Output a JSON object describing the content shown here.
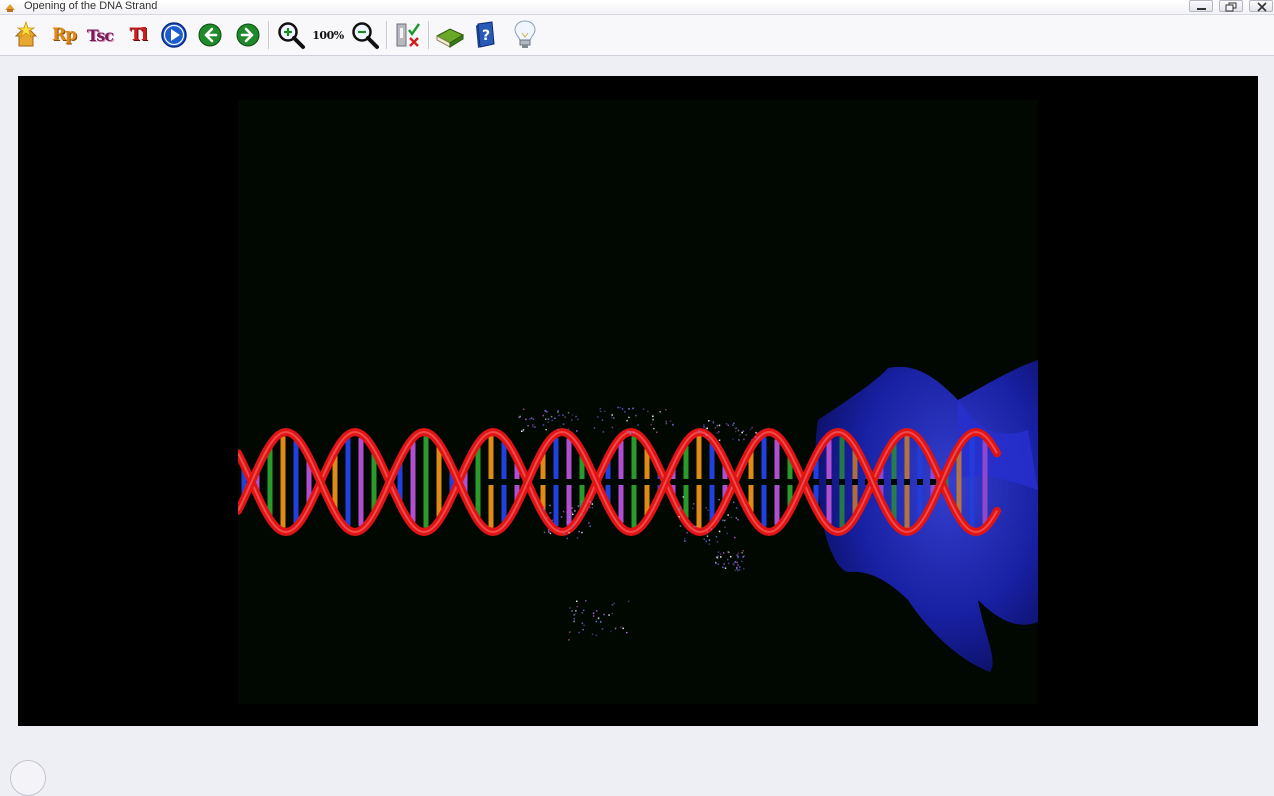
{
  "window": {
    "title": "Opening of the DNA Strand",
    "controls": [
      "minimize",
      "restore",
      "close"
    ]
  },
  "toolbar": {
    "buttons": [
      {
        "name": "home-button",
        "icon": "home-star-icon"
      },
      {
        "name": "rp-button",
        "icon": "rp-letters-icon",
        "label": "Rp",
        "color": "#e08a1a"
      },
      {
        "name": "tsc-button",
        "icon": "tsc-letters-icon",
        "label": "Tsc",
        "color": "#7a1a5a"
      },
      {
        "name": "tl-button",
        "icon": "tl-letters-icon",
        "label": "Tl",
        "color": "#d21c1c"
      },
      {
        "name": "play-button",
        "icon": "play-icon"
      },
      {
        "name": "back-button",
        "icon": "arrow-left-icon"
      },
      {
        "name": "forward-button",
        "icon": "arrow-right-icon"
      },
      {
        "name": "zoom-in-button",
        "icon": "zoom-in-icon"
      },
      {
        "name": "zoom-100-button",
        "icon": "zoom-reset-icon",
        "label": "100%"
      },
      {
        "name": "zoom-out-button",
        "icon": "zoom-out-icon"
      },
      {
        "name": "quiz-button",
        "icon": "check-cross-icon"
      },
      {
        "name": "glossary-button",
        "icon": "book-icon"
      },
      {
        "name": "help-button",
        "icon": "help-book-icon"
      },
      {
        "name": "hint-button",
        "icon": "lightbulb-icon"
      }
    ]
  },
  "colors": {
    "backbone": "#e01414",
    "bases": [
      "#2040e0",
      "#b050d0",
      "#2a9a2a",
      "#e08a1a"
    ],
    "enzyme": "#1a22b0",
    "background": "#000000"
  }
}
